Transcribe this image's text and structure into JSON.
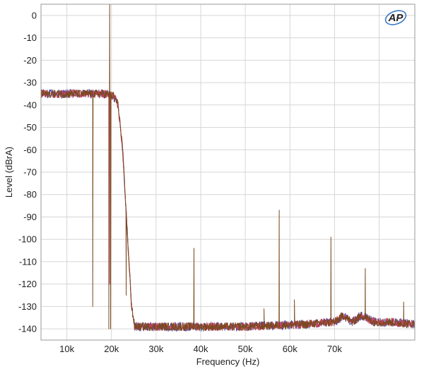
{
  "chart_data": {
    "type": "line",
    "title": "",
    "xlabel": "Frequency (Hz)",
    "ylabel": "Level (dBrA)",
    "xlim": [
      4200,
      88000
    ],
    "ylim": [
      -145,
      5
    ],
    "x_ticks": [
      10000,
      20000,
      30000,
      40000,
      50000,
      60000,
      70000
    ],
    "x_tick_labels": [
      "10k",
      "20k",
      "30k",
      "40k",
      "50k",
      "60k",
      "70k"
    ],
    "y_ticks": [
      0,
      -10,
      -20,
      -30,
      -40,
      -50,
      -60,
      -70,
      -80,
      -90,
      -100,
      -110,
      -120,
      -130,
      -140
    ],
    "y_tick_labels": [
      "0",
      "-10",
      "-20",
      "-30",
      "-40",
      "-50",
      "-60",
      "-70",
      "-80",
      "-90",
      "-100",
      "-110",
      "-120",
      "-130",
      "-140"
    ],
    "grid": true,
    "logo": "AP",
    "colors": {
      "brown": "#7a4a1e",
      "red": "#c8405a",
      "blue": "#4a4aa8",
      "grid": "#d6d6d6",
      "frame": "#9a9a9a"
    },
    "series": [
      {
        "color": "brown",
        "noise": 1.8,
        "points": [
          [
            4200,
            -35
          ],
          [
            18500,
            -35
          ],
          [
            20500,
            -36
          ],
          [
            21500,
            -40
          ],
          [
            22500,
            -60
          ],
          [
            23500,
            -95
          ],
          [
            24500,
            -130
          ],
          [
            25200,
            -139
          ],
          [
            50000,
            -139
          ],
          [
            63000,
            -138
          ],
          [
            70000,
            -137
          ],
          [
            72000,
            -134
          ],
          [
            74000,
            -137
          ],
          [
            76000,
            -134
          ],
          [
            79000,
            -137
          ],
          [
            83000,
            -137
          ],
          [
            88000,
            -138
          ]
        ],
        "spikes": [
          [
            15800,
            -130
          ],
          [
            19400,
            -140
          ],
          [
            19600,
            5
          ],
          [
            19800,
            -140
          ],
          [
            23300,
            -125
          ],
          [
            38500,
            -104
          ],
          [
            54200,
            -131
          ],
          [
            57600,
            -87
          ],
          [
            61000,
            -127
          ],
          [
            69200,
            -99
          ],
          [
            76900,
            -113
          ],
          [
            85500,
            -128
          ]
        ]
      },
      {
        "color": "red",
        "noise": 1.8,
        "points": [
          [
            4200,
            -35
          ],
          [
            18500,
            -35
          ],
          [
            20500,
            -36
          ],
          [
            21500,
            -40
          ],
          [
            22500,
            -60
          ],
          [
            23500,
            -95
          ],
          [
            24500,
            -130
          ],
          [
            25200,
            -139
          ],
          [
            50000,
            -139
          ],
          [
            63000,
            -138
          ],
          [
            70000,
            -137
          ],
          [
            72000,
            -134
          ],
          [
            74000,
            -137
          ],
          [
            76000,
            -134
          ],
          [
            79000,
            -137
          ],
          [
            83000,
            -137
          ],
          [
            88000,
            -138
          ]
        ],
        "spikes": [
          [
            19600,
            -120
          ]
        ]
      },
      {
        "color": "blue",
        "noise": 2.0,
        "points": [
          [
            4200,
            -35
          ],
          [
            18500,
            -35
          ],
          [
            20500,
            -36
          ],
          [
            21500,
            -40
          ],
          [
            22500,
            -60
          ],
          [
            23500,
            -95
          ],
          [
            24500,
            -130
          ],
          [
            25200,
            -139
          ],
          [
            50000,
            -139
          ],
          [
            63000,
            -138
          ],
          [
            70000,
            -137
          ],
          [
            72000,
            -134
          ],
          [
            74000,
            -137
          ],
          [
            76000,
            -134
          ],
          [
            79000,
            -137
          ],
          [
            83000,
            -137
          ],
          [
            88000,
            -138
          ]
        ],
        "spikes": []
      }
    ]
  }
}
